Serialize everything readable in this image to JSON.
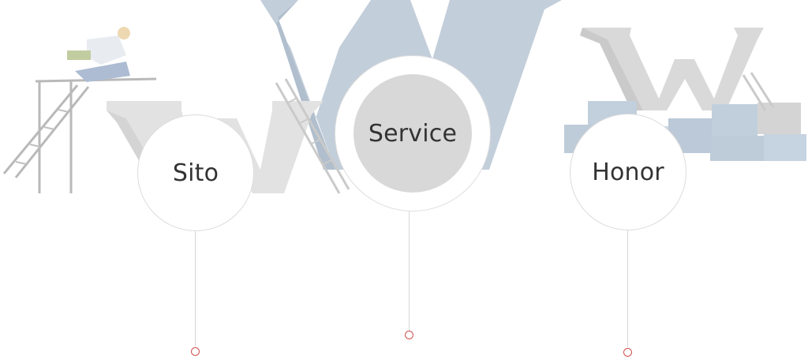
{
  "timeline": {
    "nodes": [
      {
        "id": "sito",
        "label": "Sito"
      },
      {
        "id": "service",
        "label": "Service",
        "active": true
      },
      {
        "id": "honor",
        "label": "Honor"
      }
    ]
  },
  "colors": {
    "letters_blue": "#9fb2c6",
    "letters_gray": "#cfcfcf",
    "active_fill": "#d8d8d8",
    "dot_outline": "#d0504f",
    "stem_line": "#d6d6d6"
  },
  "icons": {
    "background": "construction-www-letters-illustration"
  }
}
